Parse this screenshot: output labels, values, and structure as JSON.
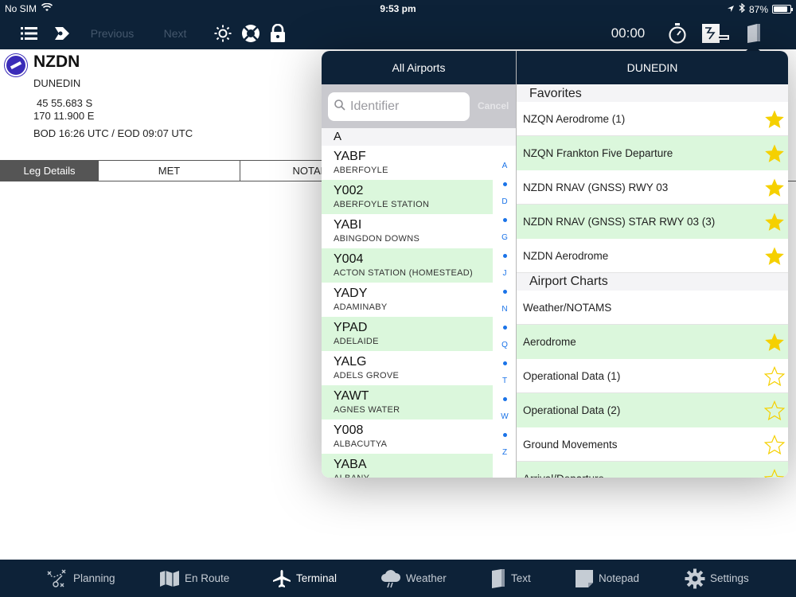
{
  "statusbar": {
    "carrier": "No SIM",
    "time": "9:53 pm",
    "battery": "87%",
    "battery_level": 0.87
  },
  "toolbar": {
    "previous": "Previous",
    "next": "Next",
    "timer": "00:00"
  },
  "airport": {
    "ident": "NZDN",
    "city": "DUNEDIN",
    "lat": "45 55.683 S",
    "lon": "170 11.900 E",
    "bod_eod": "BOD 16:26 UTC / EOD 09:07 UTC"
  },
  "tabs": [
    "Leg Details",
    "MET",
    "NOTAM"
  ],
  "popover": {
    "left_title": "All Airports",
    "right_title": "DUNEDIN",
    "search": {
      "placeholder": "Identifier",
      "cancel": "Cancel"
    },
    "section_letter": "A",
    "airports": [
      {
        "code": "YABF",
        "name": "ABERFOYLE"
      },
      {
        "code": "Y002",
        "name": "ABERFOYLE STATION"
      },
      {
        "code": "YABI",
        "name": "ABINGDON DOWNS"
      },
      {
        "code": "Y004",
        "name": "ACTON STATION (HOMESTEAD)"
      },
      {
        "code": "YADY",
        "name": "ADAMINABY"
      },
      {
        "code": "YPAD",
        "name": "ADELAIDE"
      },
      {
        "code": "YALG",
        "name": "ADELS GROVE"
      },
      {
        "code": "YAWT",
        "name": "AGNES WATER"
      },
      {
        "code": "Y008",
        "name": "ALBACUTYA"
      },
      {
        "code": "YABA",
        "name": "ALBANY"
      }
    ],
    "index_letters": [
      "A",
      "D",
      "G",
      "J",
      "N",
      "Q",
      "T",
      "W",
      "Z"
    ],
    "favorites_header": "Favorites",
    "favorites": [
      {
        "label": "NZQN Aerodrome (1)",
        "starred": true
      },
      {
        "label": "NZQN Frankton Five Departure",
        "starred": true
      },
      {
        "label": "NZDN RNAV (GNSS) RWY 03",
        "starred": true
      },
      {
        "label": "NZDN RNAV (GNSS) STAR RWY 03 (3)",
        "starred": true
      },
      {
        "label": "NZDN Aerodrome",
        "starred": true
      }
    ],
    "charts_header": "Airport Charts",
    "charts": [
      {
        "label": "Weather/NOTAMS",
        "starred": null
      },
      {
        "label": "Aerodrome",
        "starred": true
      },
      {
        "label": "Operational Data (1)",
        "starred": false
      },
      {
        "label": "Operational Data (2)",
        "starred": false
      },
      {
        "label": "Ground Movements",
        "starred": false
      },
      {
        "label": "Arrival/Departure",
        "starred": false
      }
    ]
  },
  "bottom_tabs": [
    "Planning",
    "En Route",
    "Terminal",
    "Weather",
    "Text",
    "Notepad",
    "Settings"
  ],
  "colors": {
    "navy": "#0d2238",
    "row_green": "#dbf7dc",
    "star_gold": "#f5d000",
    "index_blue": "#1a73e8",
    "dim_text": "#44576c"
  }
}
